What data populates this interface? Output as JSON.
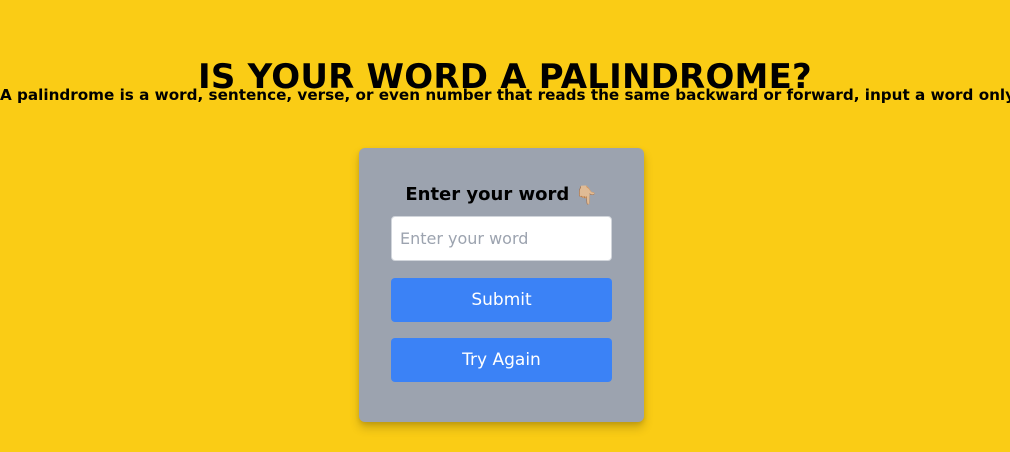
{
  "page": {
    "title": "IS YOUR WORD A PALINDROME?",
    "subtitle": "A palindrome is a word, sentence, verse, or even number that reads the same backward or forward, input a word only!"
  },
  "form": {
    "label": "Enter your word",
    "label_emoji": "👇🏼",
    "input_placeholder": "Enter your word",
    "input_value": "",
    "submit_label": "Submit",
    "try_again_label": "Try Again"
  },
  "colors": {
    "page_background": "#facc15",
    "card_background": "#9ca3af",
    "button_background": "#3b82f6",
    "button_text": "#ffffff"
  }
}
